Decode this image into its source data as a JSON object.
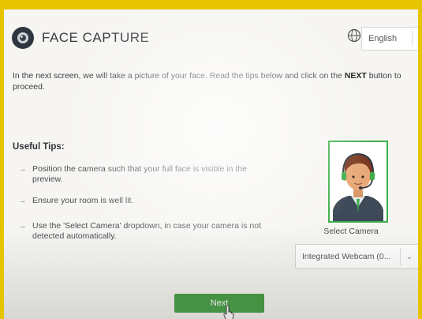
{
  "header": {
    "title": "FACE CAPTURE",
    "language": {
      "selected": "English",
      "chevron": "⌄"
    },
    "globe_icon": "globe-icon",
    "logo_icon": "camera-lens-icon"
  },
  "intro": {
    "text_before": "In the next screen, we will take a picture of your face. Read the tips below and click on the ",
    "emphasis": "NEXT",
    "text_after": " button to proceed."
  },
  "tips": {
    "title": "Useful Tips:",
    "arrow": "→",
    "items": [
      {
        "text": "Position the camera such that your full face is visible in the preview."
      },
      {
        "text": "Ensure your room is well lit."
      },
      {
        "text": "Use the 'Select Camera' dropdown, in case your camera is not detected automatically."
      }
    ]
  },
  "camera": {
    "label": "Select Camera",
    "selected": "Integrated Webcam (0...",
    "chevron": "⌄"
  },
  "actions": {
    "next_label": "Next"
  },
  "colors": {
    "accent_green": "#3d9a3c",
    "frame_green": "#3cae4a",
    "monitor_bezel": "#e7c400"
  }
}
